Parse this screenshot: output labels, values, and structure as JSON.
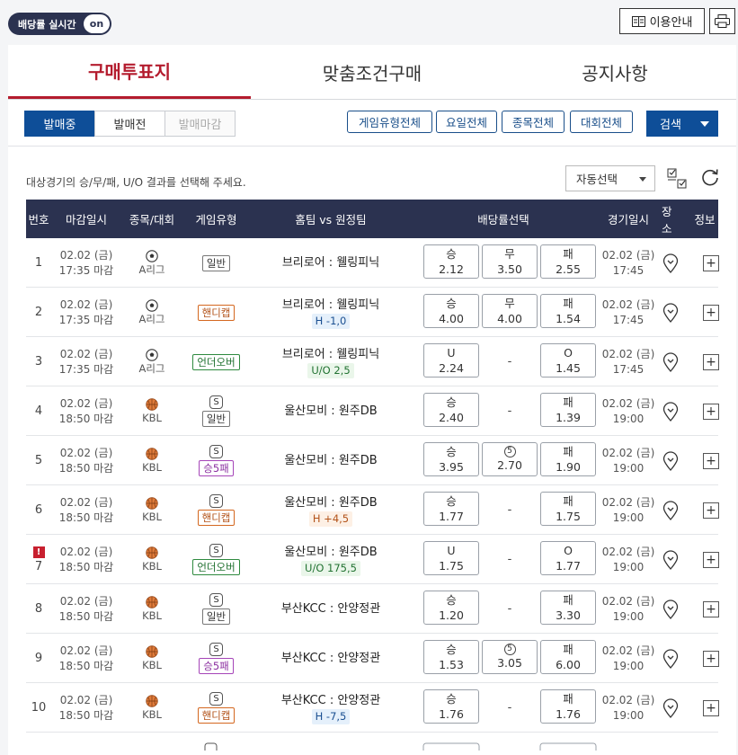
{
  "topbar": {
    "live_label": "배당률 실시간",
    "live_state": "on",
    "guide_label": "이용안내"
  },
  "tabs": [
    {
      "label": "구매투표지",
      "active": true
    },
    {
      "label": "맞춤조건구매",
      "active": false
    },
    {
      "label": "공지사항",
      "active": false
    }
  ],
  "filters": {
    "segments": [
      {
        "label": "발매중",
        "state": "active"
      },
      {
        "label": "발매전",
        "state": "normal"
      },
      {
        "label": "발매마감",
        "state": "disabled"
      }
    ],
    "buttons": [
      "게임유형전체",
      "요일전체",
      "종목전체",
      "대회전체"
    ],
    "search_label": "검색"
  },
  "instruction": "대상경기의 승/무/패, U/O 결과를 선택해 주세요.",
  "auto_select": "자동선택",
  "columns": [
    "번호",
    "마감일시",
    "종목/대회",
    "게임유형",
    "홈팀 vs 원정팀",
    "배당률선택",
    "경기일시",
    "장소",
    "정보"
  ],
  "colors": {
    "header_bg": "#2b3250",
    "accent": "#b41c2e",
    "primary": "#0e4e98"
  },
  "rows": [
    {
      "no": "1",
      "close_date": "02.02 (금)",
      "close_time": "17:35 마감",
      "sport": "soccer",
      "league": "A리그",
      "type": "일반",
      "type_style": "normal",
      "s_tag": "",
      "match": "브리로어 : 웰링피닉",
      "handicap": "",
      "hc_style": "",
      "odds": [
        {
          "label": "승",
          "value": "2.12"
        },
        {
          "label": "무",
          "value": "3.50"
        },
        {
          "label": "패",
          "value": "2.55"
        }
      ],
      "game_date": "02.02 (금)",
      "game_time": "17:45",
      "warn": false
    },
    {
      "no": "2",
      "close_date": "02.02 (금)",
      "close_time": "17:35 마감",
      "sport": "soccer",
      "league": "A리그",
      "type": "핸디캡",
      "type_style": "handi",
      "s_tag": "",
      "match": "브리로어 : 웰링피닉",
      "handicap": "H -1,0",
      "hc_style": "blue",
      "odds": [
        {
          "label": "승",
          "value": "4.00"
        },
        {
          "label": "무",
          "value": "4.00"
        },
        {
          "label": "패",
          "value": "1.54"
        }
      ],
      "game_date": "02.02 (금)",
      "game_time": "17:45",
      "warn": false
    },
    {
      "no": "3",
      "close_date": "02.02 (금)",
      "close_time": "17:35 마감",
      "sport": "soccer",
      "league": "A리그",
      "type": "언더오버",
      "type_style": "uo",
      "s_tag": "",
      "match": "브리로어 : 웰링피닉",
      "handicap": "U/O 2,5",
      "hc_style": "green",
      "odds": [
        {
          "label": "U",
          "value": "2.24"
        },
        {
          "label": "",
          "value": "-"
        },
        {
          "label": "O",
          "value": "1.45"
        }
      ],
      "game_date": "02.02 (금)",
      "game_time": "17:45",
      "warn": false
    },
    {
      "no": "4",
      "close_date": "02.02 (금)",
      "close_time": "18:50 마감",
      "sport": "basketball",
      "league": "KBL",
      "type": "일반",
      "type_style": "normal",
      "s_tag": "S",
      "match": "울산모비 : 원주DB",
      "handicap": "",
      "hc_style": "",
      "odds": [
        {
          "label": "승",
          "value": "2.40"
        },
        {
          "label": "",
          "value": "-"
        },
        {
          "label": "패",
          "value": "1.39"
        }
      ],
      "game_date": "02.02 (금)",
      "game_time": "19:00",
      "warn": false
    },
    {
      "no": "5",
      "close_date": "02.02 (금)",
      "close_time": "18:50 마감",
      "sport": "basketball",
      "league": "KBL",
      "type": "승5패",
      "type_style": "w5",
      "s_tag": "S",
      "match": "울산모비 : 원주DB",
      "handicap": "",
      "hc_style": "",
      "odds": [
        {
          "label": "승",
          "value": "3.95"
        },
        {
          "label": "⑤",
          "value": "2.70"
        },
        {
          "label": "패",
          "value": "1.90"
        }
      ],
      "game_date": "02.02 (금)",
      "game_time": "19:00",
      "warn": false
    },
    {
      "no": "6",
      "close_date": "02.02 (금)",
      "close_time": "18:50 마감",
      "sport": "basketball",
      "league": "KBL",
      "type": "핸디캡",
      "type_style": "handi",
      "s_tag": "S",
      "match": "울산모비 : 원주DB",
      "handicap": "H +4,5",
      "hc_style": "orange",
      "odds": [
        {
          "label": "승",
          "value": "1.77"
        },
        {
          "label": "",
          "value": "-"
        },
        {
          "label": "패",
          "value": "1.75"
        }
      ],
      "game_date": "02.02 (금)",
      "game_time": "19:00",
      "warn": false
    },
    {
      "no": "7",
      "close_date": "02.02 (금)",
      "close_time": "18:50 마감",
      "sport": "basketball",
      "league": "KBL",
      "type": "언더오버",
      "type_style": "uo",
      "s_tag": "S",
      "match": "울산모비 : 원주DB",
      "handicap": "U/O 175,5",
      "hc_style": "green",
      "odds": [
        {
          "label": "U",
          "value": "1.75"
        },
        {
          "label": "",
          "value": "-"
        },
        {
          "label": "O",
          "value": "1.77"
        }
      ],
      "game_date": "02.02 (금)",
      "game_time": "19:00",
      "warn": true
    },
    {
      "no": "8",
      "close_date": "02.02 (금)",
      "close_time": "18:50 마감",
      "sport": "basketball",
      "league": "KBL",
      "type": "일반",
      "type_style": "normal",
      "s_tag": "S",
      "match": "부산KCC : 안양정관",
      "handicap": "",
      "hc_style": "",
      "odds": [
        {
          "label": "승",
          "value": "1.20"
        },
        {
          "label": "",
          "value": "-"
        },
        {
          "label": "패",
          "value": "3.30"
        }
      ],
      "game_date": "02.02 (금)",
      "game_time": "19:00",
      "warn": false
    },
    {
      "no": "9",
      "close_date": "02.02 (금)",
      "close_time": "18:50 마감",
      "sport": "basketball",
      "league": "KBL",
      "type": "승5패",
      "type_style": "w5",
      "s_tag": "S",
      "match": "부산KCC : 안양정관",
      "handicap": "",
      "hc_style": "",
      "odds": [
        {
          "label": "승",
          "value": "1.53"
        },
        {
          "label": "⑤",
          "value": "3.05"
        },
        {
          "label": "패",
          "value": "6.00"
        }
      ],
      "game_date": "02.02 (금)",
      "game_time": "19:00",
      "warn": false
    },
    {
      "no": "10",
      "close_date": "02.02 (금)",
      "close_time": "18:50 마감",
      "sport": "basketball",
      "league": "KBL",
      "type": "핸디캡",
      "type_style": "handi",
      "s_tag": "S",
      "match": "부산KCC : 안양정관",
      "handicap": "H -7,5",
      "hc_style": "blue",
      "odds": [
        {
          "label": "승",
          "value": "1.76"
        },
        {
          "label": "",
          "value": "-"
        },
        {
          "label": "패",
          "value": "1.76"
        }
      ],
      "game_date": "02.02 (금)",
      "game_time": "19:00",
      "warn": false
    }
  ]
}
